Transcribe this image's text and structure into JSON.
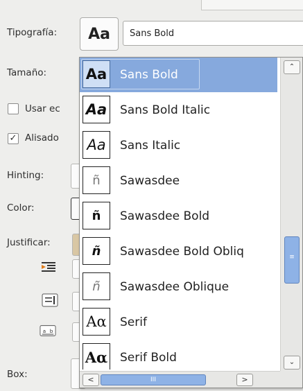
{
  "labels": {
    "typography": "Tipografía:",
    "size": "Tamaño:",
    "use_editor": "Usar ec",
    "antialias": "Alisado",
    "hinting": "Hinting:",
    "color": "Color:",
    "justify": "Justificar:",
    "box": "Box:"
  },
  "checkboxes": {
    "use_editor_checked": false,
    "antialias_checked": true
  },
  "font_selector": {
    "preview_glyph": "Aa",
    "current_value": "Sans Bold"
  },
  "popup": {
    "items": [
      {
        "glyph": "Aa",
        "label": "Sans Bold"
      },
      {
        "glyph": "Aa",
        "label": "Sans Bold Italic"
      },
      {
        "glyph": "Aa",
        "label": "Sans Italic"
      },
      {
        "glyph": "ñ",
        "label": "Sawasdee"
      },
      {
        "glyph": "ñ",
        "label": "Sawasdee Bold"
      },
      {
        "glyph": "ñ",
        "label": "Sawasdee Bold Obliq"
      },
      {
        "glyph": "ñ",
        "label": "Sawasdee Oblique"
      },
      {
        "glyph": "Aα",
        "label": "Serif"
      },
      {
        "glyph": "Aα",
        "label": "Serif Bold"
      }
    ],
    "selected_index": 0
  },
  "scrollbar": {
    "thumb_grip": "≡",
    "hthumb_grip": "III",
    "up": "⌃",
    "down": "⌄",
    "left": "<",
    "right": ">"
  },
  "colors": {
    "selection": "#86a9dd",
    "scroll_thumb": "#8eb2e6",
    "window_bg": "#eeeeec"
  }
}
